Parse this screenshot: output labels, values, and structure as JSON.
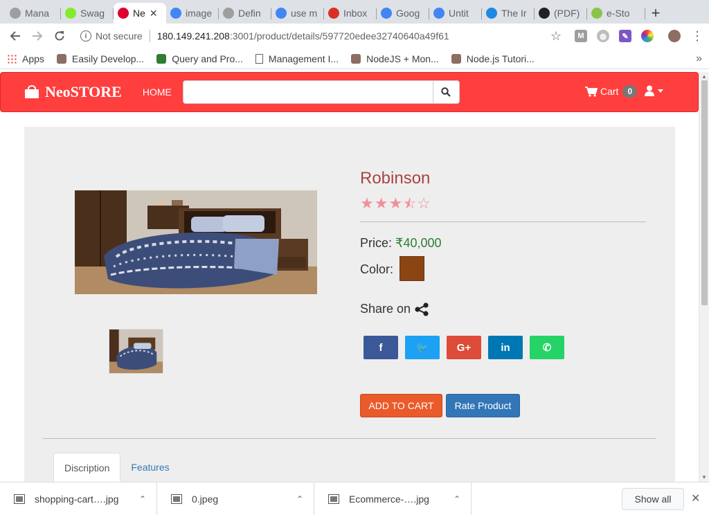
{
  "browser": {
    "tabs": [
      {
        "title": "Mana",
        "icon": "document-icon",
        "color": "#9e9e9e"
      },
      {
        "title": "Swag",
        "icon": "swagger-icon",
        "color": "#85ea2d"
      },
      {
        "title": "Ne",
        "icon": "angular-icon",
        "color": "#dd0031",
        "active": true
      },
      {
        "title": "image",
        "icon": "google-icon",
        "color": "#4285f4"
      },
      {
        "title": "Defin",
        "icon": "document-icon",
        "color": "#9e9e9e"
      },
      {
        "title": "use m",
        "icon": "google-icon",
        "color": "#4285f4"
      },
      {
        "title": "Inbox",
        "icon": "gmail-icon",
        "color": "#d93025"
      },
      {
        "title": "Goog",
        "icon": "google-docs-icon",
        "color": "#4285f4"
      },
      {
        "title": "Untit",
        "icon": "google-docs-icon",
        "color": "#4285f4"
      },
      {
        "title": "The Ir",
        "icon": "site-icon",
        "color": "#1e88e5"
      },
      {
        "title": "(PDF)",
        "icon": "academia-icon",
        "color": "#202124"
      },
      {
        "title": "e-Sto",
        "icon": "android-icon",
        "color": "#8bc34a"
      }
    ],
    "security_label": "Not secure",
    "url_host": "180.149.241.208",
    "url_path": ":3001/product/details/597720edee32740640a49f61",
    "bookmarks": [
      {
        "label": "Apps",
        "icon": "apps-grid-icon"
      },
      {
        "label": "Easily Develop...",
        "icon": "bookmark-icon"
      },
      {
        "label": "Query and Pro...",
        "icon": "mongodb-icon"
      },
      {
        "label": "Management I...",
        "icon": "page-icon"
      },
      {
        "label": "NodeJS + Mon...",
        "icon": "bookmark-icon"
      },
      {
        "label": "Node.js Tutori...",
        "icon": "bookmark-icon"
      }
    ],
    "bookmarks_more": "»"
  },
  "store": {
    "brand": "NeoSTORE",
    "nav_home": "HOME",
    "search_placeholder": "",
    "cart_label": "Cart",
    "cart_count": "0",
    "accent_color": "#ff3e3e"
  },
  "product": {
    "name": "Robinson",
    "rating": 3.5,
    "rating_max": 5,
    "price_label": "Price:",
    "price_value": "₹40,000",
    "color_label": "Color:",
    "color_value": "#8b4513",
    "share_label": "Share on",
    "social": [
      {
        "name": "facebook",
        "glyph": "f",
        "color": "#3b5998"
      },
      {
        "name": "twitter",
        "glyph": "🐦",
        "color": "#1da1f2"
      },
      {
        "name": "google-plus",
        "glyph": "G+",
        "color": "#dd4b39"
      },
      {
        "name": "linkedin",
        "glyph": "in",
        "color": "#0077b5"
      },
      {
        "name": "whatsapp",
        "glyph": "✆",
        "color": "#25d366"
      }
    ],
    "add_to_cart": "ADD TO CART",
    "rate_product": "Rate Product",
    "tabs": [
      "Discription",
      "Features"
    ]
  },
  "downloads": {
    "items": [
      "shopping-cart….jpg",
      "0.jpeg",
      "Ecommerce-….jpg"
    ],
    "show_all": "Show all"
  }
}
